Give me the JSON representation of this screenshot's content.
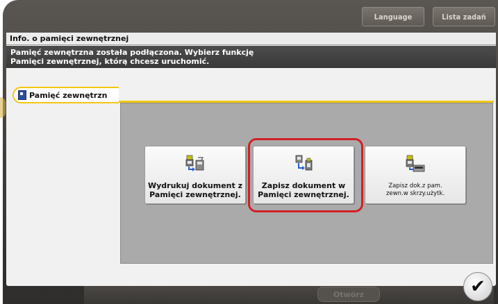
{
  "header": {
    "language_label": "Language",
    "jobs_label": "Lista zadań"
  },
  "dialog": {
    "title": "Info. o pamięci zewnętrznej",
    "message_line1": "Pamięć zewnętrzna została podłączona. Wybierz funkcję",
    "message_line2": "Pamięci zewnętrznej, którą chcesz uruchomić."
  },
  "side_tab": {
    "label": "Pamięć zewnętrzn",
    "icon": "usb-memory-icon"
  },
  "functions": [
    {
      "line1": "Wydrukuj dokument z",
      "line2": "Pamięci zewnętrznej.",
      "icon": "print-from-usb-icon"
    },
    {
      "line1": "Zapisz dokument w",
      "line2": "Pamięci zewnętrznej.",
      "icon": "save-to-usb-icon",
      "highlighted": true
    },
    {
      "line1": "Zapisz dok.z pam.",
      "line2": "zewn.w skrzy.użytk.",
      "icon": "save-to-box-icon"
    }
  ],
  "footer": {
    "open_label": "Otwórz",
    "ok_icon": "checkmark-icon"
  },
  "colors": {
    "accent": "#f2c811",
    "highlight": "#d31e25",
    "message_bg": "#3f3f3f",
    "panel_bg": "#aaaaaa"
  }
}
